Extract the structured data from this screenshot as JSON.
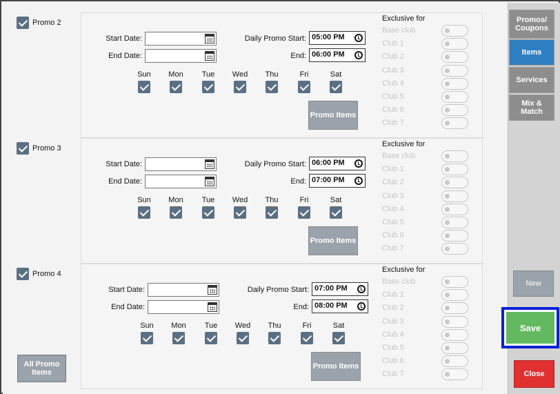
{
  "promos": [
    {
      "name": "Promo 2",
      "start_date_label": "Start Date:",
      "end_date_label": "End Date:",
      "start_date": "",
      "end_date": "",
      "daily_start_label": "Daily Promo Start:",
      "end_label": "End:",
      "daily_start": "05:00 PM",
      "daily_end": "06:00 PM",
      "days": [
        "Sun",
        "Mon",
        "Tue",
        "Wed",
        "Thu",
        "Fri",
        "Sat"
      ],
      "promo_items_label": "Promo Items",
      "exclusive_title": "Exclusive for",
      "clubs": [
        "Base club",
        "Club 1",
        "Club 2",
        "Club 3",
        "Club 4",
        "Club 5",
        "Club 6",
        "Club 7"
      ]
    },
    {
      "name": "Promo 3",
      "start_date_label": "Start Date:",
      "end_date_label": "End Date:",
      "start_date": "",
      "end_date": "",
      "daily_start_label": "Daily Promo Start:",
      "end_label": "End:",
      "daily_start": "06:00 PM",
      "daily_end": "07:00 PM",
      "days": [
        "Sun",
        "Mon",
        "Tue",
        "Wed",
        "Thu",
        "Fri",
        "Sat"
      ],
      "promo_items_label": "Promo Items",
      "exclusive_title": "Exclusive for",
      "clubs": [
        "Base club",
        "Club 1",
        "Club 2",
        "Club 3",
        "Club 4",
        "Club 5",
        "Club 6",
        "Club 7"
      ]
    },
    {
      "name": "Promo 4",
      "start_date_label": "Start Date:",
      "end_date_label": "End Date:",
      "start_date": "",
      "end_date": "",
      "daily_start_label": "Daily Promo Start:",
      "end_label": "End:",
      "daily_start": "07:00 PM",
      "daily_end": "08:00 PM",
      "days": [
        "Sun",
        "Mon",
        "Tue",
        "Wed",
        "Thu",
        "Fri",
        "Sat"
      ],
      "promo_items_label": "Promo Items",
      "exclusive_title": "Exclusive for",
      "clubs": [
        "Base club",
        "Club 1",
        "Club 2",
        "Club 3",
        "Club 4",
        "Club 5",
        "Club 6",
        "Club 7"
      ]
    }
  ],
  "all_promo_items_label": "All Promo Items",
  "sidebar": {
    "tabs": [
      "Promos/ Coupons",
      "Items",
      "Services",
      "Mix & Match"
    ],
    "active_tab": "Items",
    "new_label": "New",
    "save_label": "Save",
    "close_label": "Close"
  },
  "colors": {
    "active_tab": "#2d7fc2",
    "save": "#63b960",
    "close": "#e03030",
    "save_focus_border": "#0a21d6",
    "checkbox": "#5a6f82"
  }
}
